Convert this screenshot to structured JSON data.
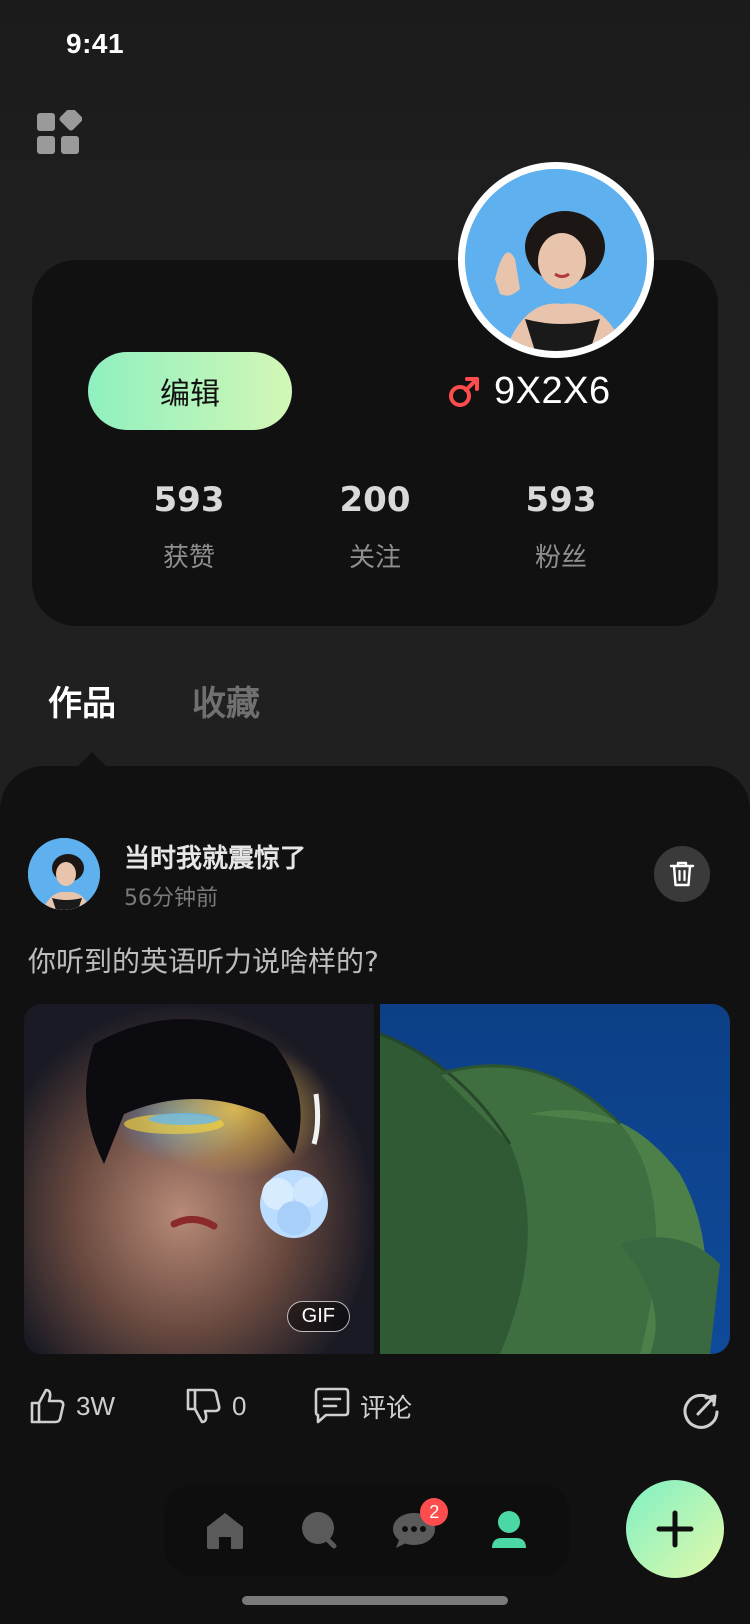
{
  "status_bar": {
    "time": "9:41"
  },
  "profile": {
    "username": "9X2X6",
    "gender_icon": "male-icon",
    "edit_label": "编辑",
    "stats": [
      {
        "value": "593",
        "label": "获赞"
      },
      {
        "value": "200",
        "label": "关注"
      },
      {
        "value": "593",
        "label": "粉丝"
      }
    ]
  },
  "tabs": [
    {
      "label": "作品",
      "active": true
    },
    {
      "label": "收藏",
      "active": false
    }
  ],
  "post": {
    "author": "当时我就震惊了",
    "time": "56分钟前",
    "text": "你听到的英语听力说啥样的?",
    "gif_badge": "GIF",
    "actions": {
      "likes": "3W",
      "dislikes": "0",
      "comment_label": "评论"
    }
  },
  "bottom_nav": {
    "items": [
      "home-icon",
      "discover-icon",
      "messages-icon",
      "profile-icon"
    ],
    "message_badge": "2",
    "active": "profile-icon"
  },
  "colors": {
    "accent_start": "#8ff0c0",
    "accent_end": "#d3f7b6",
    "gender_male": "#ff4d4d",
    "active_nav": "#4cd8a4",
    "badge": "#ff4d4d"
  }
}
